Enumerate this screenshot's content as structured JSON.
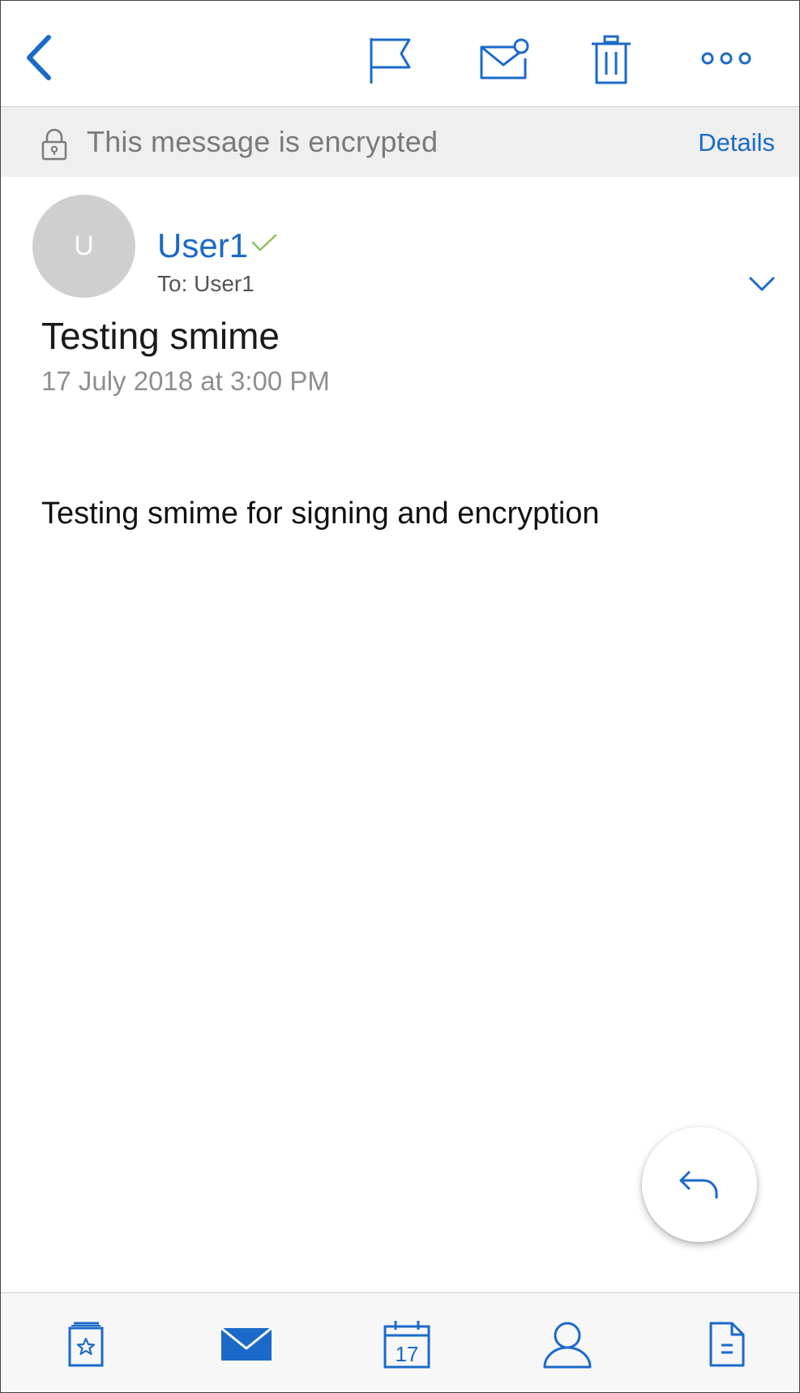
{
  "icons": {
    "back": "chevron-left-icon",
    "flag": "flag-icon",
    "mark_unread": "mail-unread-icon",
    "delete": "trash-icon",
    "more": "more-horizontal-icon",
    "lock": "lock-icon",
    "verified": "checkmark-icon",
    "expand": "chevron-down-icon",
    "reply": "reply-icon",
    "favorites": "favorites-icon",
    "mail": "mail-icon",
    "calendar": "calendar-icon",
    "contacts": "person-icon",
    "documents": "document-icon"
  },
  "colors": {
    "accent": "#1b6ac9",
    "verified_green": "#8cc35a",
    "banner_bg": "#efefef"
  },
  "banner": {
    "text": "This message is encrypted",
    "details_label": "Details"
  },
  "message": {
    "avatar_initial": "U",
    "sender": "User1",
    "to_line": "To: User1",
    "subject": "Testing smime",
    "date": "17 July 2018 at 3:00 PM",
    "body": "Testing smime for signing and encryption"
  },
  "tabbar": {
    "calendar_day": "17"
  }
}
